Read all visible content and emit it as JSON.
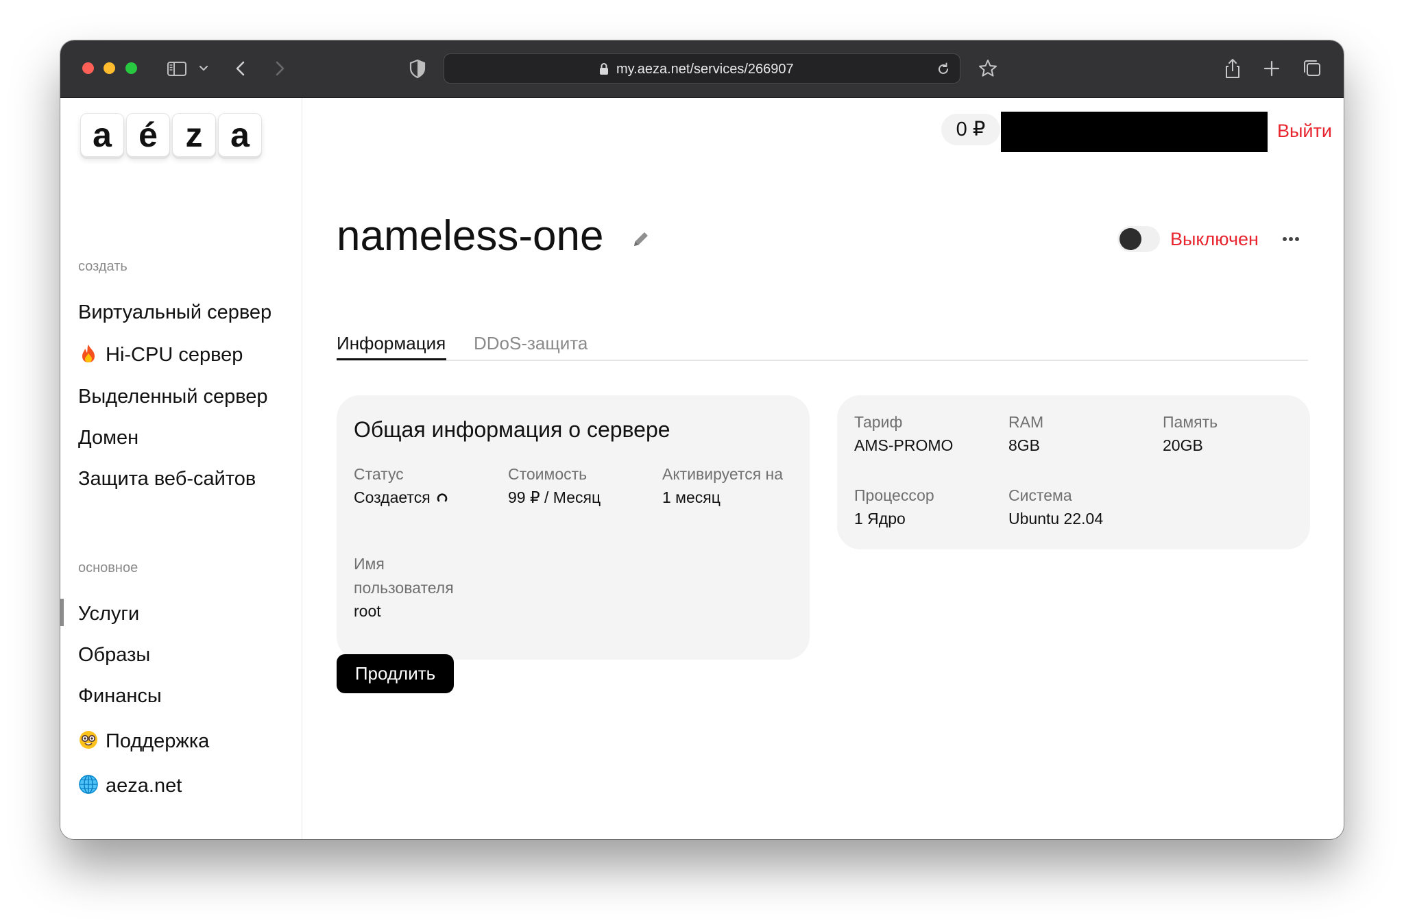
{
  "browser": {
    "url": "my.aeza.net/services/266907"
  },
  "logo": {
    "letters": [
      "a",
      "é",
      "z",
      "a"
    ]
  },
  "sidebar": {
    "create_heading": "создать",
    "create_items": [
      {
        "label": "Виртуальный сервер",
        "icon": ""
      },
      {
        "label": "Hi-CPU сервер",
        "icon": "fire-emoji"
      },
      {
        "label": "Выделенный сервер",
        "icon": ""
      },
      {
        "label": "Домен",
        "icon": ""
      },
      {
        "label": "Защита веб-сайтов",
        "icon": ""
      }
    ],
    "main_heading": "основное",
    "main_items": [
      {
        "label": "Услуги",
        "icon": "",
        "active": true
      },
      {
        "label": "Образы",
        "icon": ""
      },
      {
        "label": "Финансы",
        "icon": ""
      },
      {
        "label": "Поддержка",
        "icon": "nerd-face-emoji"
      },
      {
        "label": "aeza.net",
        "icon": "globe-emoji"
      }
    ]
  },
  "header": {
    "balance": "0 ₽",
    "logout_label": "Выйти"
  },
  "server": {
    "name": "nameless-one",
    "power_state": "Выключен",
    "power_on": false
  },
  "tabs": [
    {
      "label": "Информация",
      "active": true
    },
    {
      "label": "DDoS-защита",
      "active": false
    }
  ],
  "general_info": {
    "title": "Общая информация о сервере",
    "status_label": "Статус",
    "status_value": "Создается",
    "cost_label": "Стоимость",
    "cost_value": "99 ₽ / Месяц",
    "activate_label": "Активируется на",
    "activate_value": "1 месяц",
    "username_label_1": "Имя",
    "username_label_2": "пользователя",
    "username_value": "root"
  },
  "specs": {
    "tariff_label": "Тариф",
    "tariff_value": "AMS-PROMO",
    "ram_label": "RAM",
    "ram_value": "8GB",
    "storage_label": "Память",
    "storage_value": "20GB",
    "cpu_label": "Процессор",
    "cpu_value": "1 Ядро",
    "os_label": "Система",
    "os_value": "Ubuntu 22.04"
  },
  "actions": {
    "renew_label": "Продлить"
  },
  "colors": {
    "danger": "#e8242f",
    "card_bg": "#f4f4f4",
    "titlebar_bg": "#333335",
    "primary_button": "#000000"
  }
}
